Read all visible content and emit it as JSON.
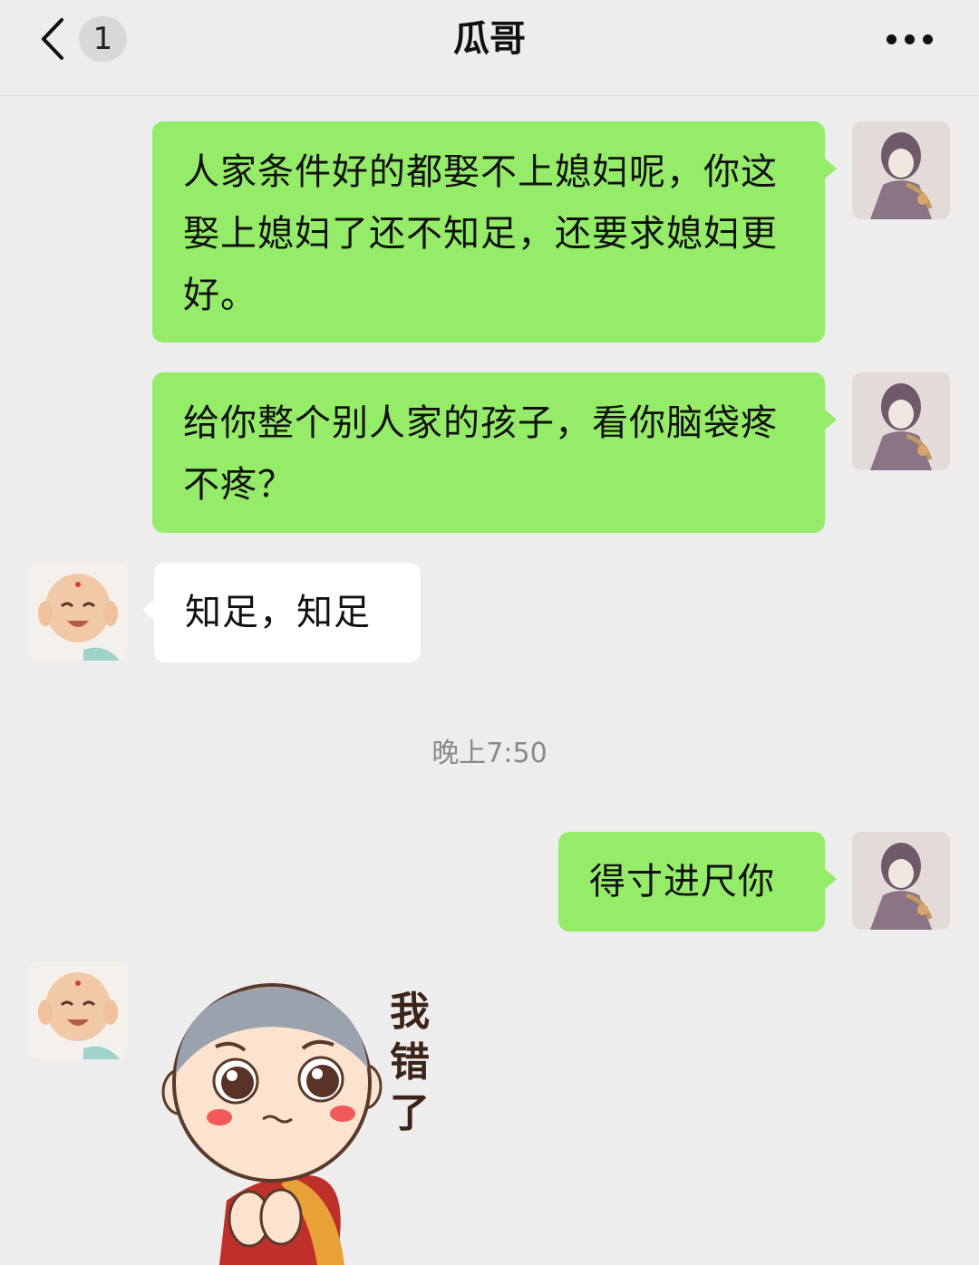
{
  "header": {
    "back_icon": "chevron-left-icon",
    "unread_count": "1",
    "title": "瓜哥",
    "more_icon": "more-dots-icon"
  },
  "messages": [
    {
      "side": "sent",
      "type": "text",
      "text": "人家条件好的都娶不上媳妇呢，你这娶上媳妇了还不知足，还要求媳妇更好。"
    },
    {
      "side": "sent",
      "type": "text",
      "text": "给你整个别人家的孩子，看你脑袋疼不疼？"
    },
    {
      "side": "received",
      "type": "text",
      "text": "知足，知足"
    },
    {
      "type": "timestamp",
      "text": "晚上7:50"
    },
    {
      "side": "sent",
      "type": "text",
      "text": "得寸进尺你"
    },
    {
      "side": "received",
      "type": "sticker",
      "sticker_text": "我错了",
      "icon": "monk-sticker"
    }
  ],
  "colors": {
    "background": "#ededed",
    "sent_bubble": "#95ec69",
    "received_bubble": "#ffffff",
    "timestamp": "#8a8a8a"
  }
}
